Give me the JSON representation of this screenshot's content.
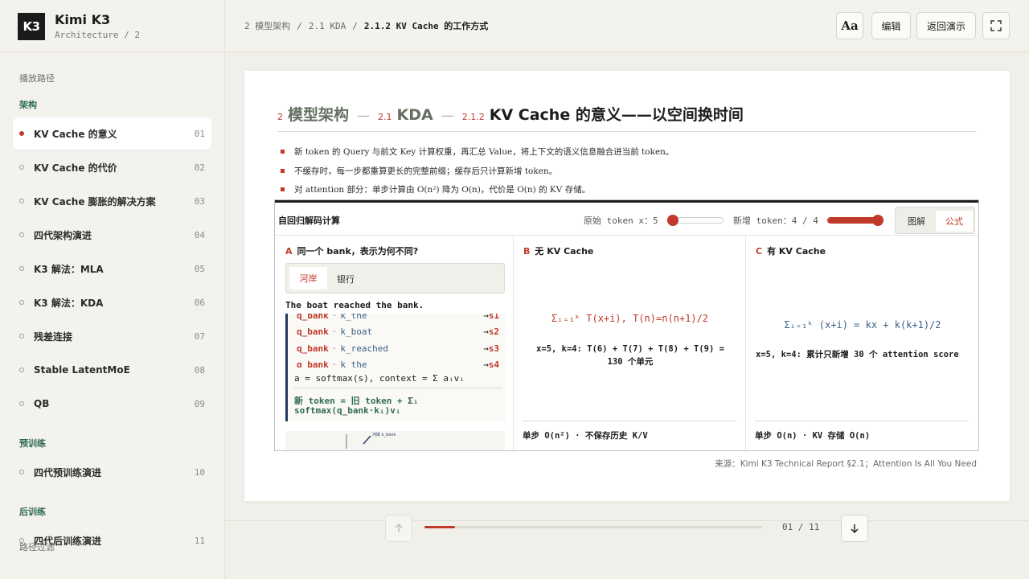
{
  "sidebar": {
    "brand_logo": "K3",
    "brand_title": "Kimi K3",
    "brand_subtitle": "Architecture / 2",
    "path_label": "播放路径",
    "filter_label": "路径过滤",
    "sections": [
      {
        "label": "架构",
        "items": [
          {
            "label": "KV Cache 的意义",
            "num": "01",
            "active": true
          },
          {
            "label": "KV Cache 的代价",
            "num": "02"
          },
          {
            "label": "KV Cache 膨胀的解决方案",
            "num": "03"
          },
          {
            "label": "四代架构演进",
            "num": "04"
          },
          {
            "label": "K3 解法：MLA",
            "num": "05"
          },
          {
            "label": "K3 解法：KDA",
            "num": "06"
          },
          {
            "label": "残差连接",
            "num": "07"
          },
          {
            "label": "Stable LatentMoE",
            "num": "08"
          },
          {
            "label": "QB",
            "num": "09"
          }
        ]
      },
      {
        "label": "预训练",
        "items": [
          {
            "label": "四代预训练演进",
            "num": "10"
          }
        ]
      },
      {
        "label": "后训练",
        "items": [
          {
            "label": "四代后训练演进",
            "num": "11"
          }
        ]
      }
    ]
  },
  "topbar": {
    "breadcrumb": [
      "2 模型架构",
      "2.1 KDA",
      "2.1.2 KV Cache 的工作方式"
    ],
    "breadcrumb_sep": "/",
    "font_button": "Aa",
    "edit_button": "编辑",
    "back_button": "返回演示"
  },
  "slide": {
    "title": {
      "n1": "2",
      "s1": "模型架构",
      "n2": "2.1",
      "s2": "KDA",
      "n3": "2.1.2",
      "main": "KV Cache 的意义——以空间换时间",
      "sep": "—"
    },
    "bullets": [
      "新 token 的 Query 与前文 Key 计算权重，再汇总 Value，将上下文的语义信息融合进当前 token。",
      "不缓存时，每一步都重算更长的完整前缀；缓存后只计算新增 token。",
      "对 attention 部分：单步计算由 O(n²) 降为 O(n)，代价是 O(n) 的 KV 存储。"
    ],
    "panel": {
      "title": "自回归解码计算",
      "slider1_label": "原始 token x：5",
      "slider1_value": 0,
      "slider2_label": "新增 token：4 / 4",
      "slider2_value": 1,
      "toggle_diagram": "图解",
      "toggle_formula": "公式",
      "colA": {
        "letter": "A",
        "title": "同一个 bank，表示为何不同?",
        "tab_active": "河岸",
        "tab_other": "银行",
        "sentence": "The boat reached the bank.",
        "rows": [
          {
            "q": "q_bank",
            "dot": "·",
            "k": "k_the",
            "arrow": "→",
            "s": "s1"
          },
          {
            "q": "q_bank",
            "dot": "·",
            "k": "k_boat",
            "arrow": "→",
            "s": "s2"
          },
          {
            "q": "q_bank",
            "dot": "·",
            "k": "k_reached",
            "arrow": "→",
            "s": "s3"
          },
          {
            "q": "q_bank",
            "dot": "·",
            "k": "k_the",
            "arrow": "→",
            "s": "s4"
          }
        ],
        "softmax": "a = softmax(s), context = Σ aᵢvᵢ",
        "update_line1": "新 token = 旧 token + Σᵢ",
        "update_line2": "softmax(q_bank·kᵢ)vᵢ",
        "thumb_label": "河岸 k_bank"
      },
      "colB": {
        "letter": "B",
        "title": "无 KV Cache",
        "formula": "Σᵢ₌₁ᵏ T(x+i), T(n)=n(n+1)/2",
        "calc_line1": "x=5, k=4: T(6) + T(7) + T(8) + T(9) =",
        "calc_line2": "130 个单元",
        "footer": "单步 O(n²) · 不保存历史 K/V"
      },
      "colC": {
        "letter": "C",
        "title": "有 KV Cache",
        "formula": "Σᵢ₌₁ᵏ (x+i) = kx + k(k+1)/2",
        "calc": "x=5, k=4: 累计只新增 30 个 attention score",
        "footer": "单步 O(n) · KV 存储 O(n)"
      }
    },
    "source": "来源：Kimi K3 Technical Report §2.1；Attention Is All You Need"
  },
  "bottombar": {
    "progress": 0.09,
    "counter": "01 / 11"
  },
  "colors": {
    "accent_red": "#c0392b",
    "accent_green": "#2f6a55",
    "accent_blue": "#3a5f8a"
  }
}
